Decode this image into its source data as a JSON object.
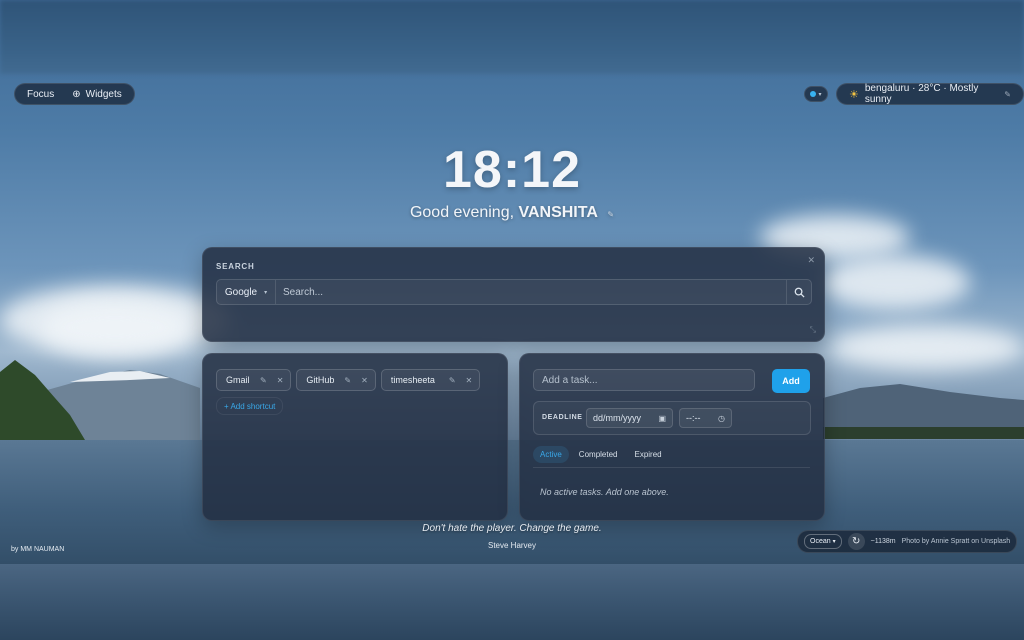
{
  "top_left": {
    "focus_label": "Focus",
    "widgets_label": "Widgets"
  },
  "weather": {
    "text": "bengaluru · 28°C · Mostly sunny"
  },
  "clock": {
    "time": "18:12"
  },
  "greeting": {
    "prefix": "Good evening,",
    "name": "VANSHITA"
  },
  "search": {
    "label": "SEARCH",
    "engine": "Google",
    "placeholder": "Search..."
  },
  "shortcuts": {
    "items": [
      {
        "label": "Gmail"
      },
      {
        "label": "GitHub"
      },
      {
        "label": "timesheeta"
      }
    ],
    "add_label": "+ Add shortcut"
  },
  "tasks": {
    "input_placeholder": "Add a task...",
    "add_label": "Add",
    "deadline_label": "DEADLINE",
    "date_placeholder": "dd/mm/yyyy",
    "time_placeholder": "--:--",
    "tabs": [
      {
        "label": "Active"
      },
      {
        "label": "Completed"
      },
      {
        "label": "Expired"
      }
    ],
    "empty_message": "No active tasks. Add one above."
  },
  "quote": {
    "text": "Don't hate the player. Change the game.",
    "author": "Steve Harvey"
  },
  "footer": {
    "credit_left": "by MM NAUMAN",
    "theme": "Ocean",
    "elevation": "~1138m",
    "photo_credit": "Photo by Annie Spratt on Unsplash"
  },
  "colors": {
    "accent": "#1fa1ea",
    "panel": "#232e42"
  }
}
